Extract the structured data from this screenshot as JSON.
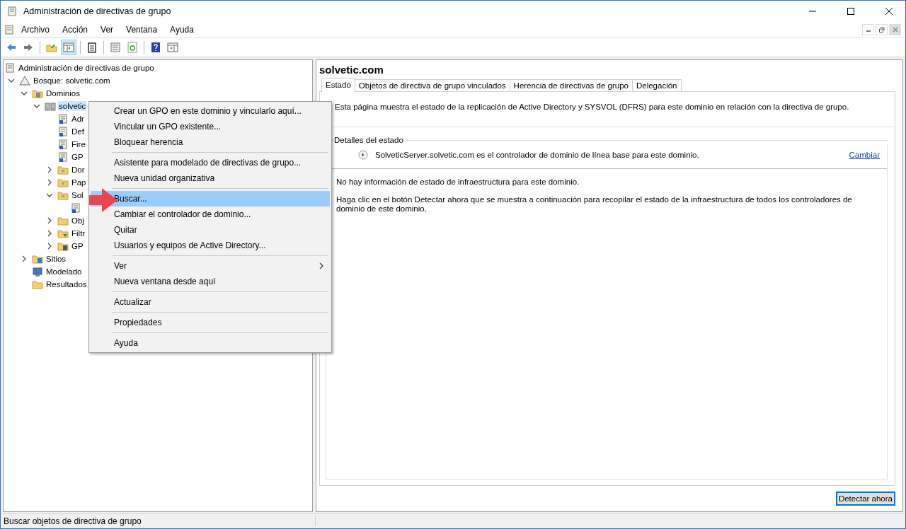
{
  "window": {
    "title": "Administración de directivas de grupo"
  },
  "menu_bar": [
    "Archivo",
    "Acción",
    "Ver",
    "Ventana",
    "Ayuda"
  ],
  "toolbar": [
    {
      "kind": "back",
      "pressed": false
    },
    {
      "kind": "forward",
      "pressed": false
    },
    {
      "kind": "separator"
    },
    {
      "kind": "up-folder",
      "pressed": false
    },
    {
      "kind": "tree-pane",
      "pressed": true
    },
    {
      "kind": "separator"
    },
    {
      "kind": "clipboard",
      "pressed": false
    },
    {
      "kind": "separator"
    },
    {
      "kind": "export",
      "pressed": false
    },
    {
      "kind": "refresh",
      "pressed": false
    },
    {
      "kind": "separator"
    },
    {
      "kind": "help",
      "pressed": false
    },
    {
      "kind": "action-pane",
      "pressed": false
    }
  ],
  "tree": [
    {
      "label": "Administración de directivas de grupo",
      "kind": "root",
      "selected": false,
      "children": [
        {
          "label": "Bosque: solvetic.com",
          "kind": "forest",
          "expanded": true,
          "selected": false,
          "children": [
            {
              "label": "Dominios",
              "kind": "domains",
              "expanded": true,
              "selected": false,
              "children": [
                {
                  "label": "solvetic",
                  "kind": "domain",
                  "expanded": true,
                  "selected": true,
                  "children": [
                    {
                      "label": "Adr",
                      "kind": "gpo",
                      "selected": false
                    },
                    {
                      "label": "Def",
                      "kind": "gpo",
                      "selected": false
                    },
                    {
                      "label": "Fire",
                      "kind": "gpo",
                      "selected": false
                    },
                    {
                      "label": "GP",
                      "kind": "gpo",
                      "selected": false
                    },
                    {
                      "label": "Dor",
                      "kind": "ou",
                      "expanded": false,
                      "selected": false
                    },
                    {
                      "label": "Pap",
                      "kind": "ou",
                      "expanded": false,
                      "selected": false
                    },
                    {
                      "label": "Sol",
                      "kind": "ou",
                      "expanded": true,
                      "selected": false,
                      "children": [
                        {
                          "kind": "gpo"
                        }
                      ]
                    },
                    {
                      "label": "Obj",
                      "kind": "gpo-folder",
                      "expanded": false,
                      "selected": false
                    },
                    {
                      "label": "Filtr",
                      "kind": "filter-folder",
                      "expanded": false,
                      "selected": false
                    },
                    {
                      "label": "GP",
                      "kind": "starter-folder",
                      "expanded": false,
                      "selected": false
                    }
                  ]
                }
              ]
            },
            {
              "label": "Sitios",
              "kind": "sites",
              "expanded": false,
              "selected": false
            },
            {
              "label": "Modelado",
              "kind": "modeling",
              "selected": false
            },
            {
              "label": "Resultados",
              "kind": "results",
              "selected": false
            }
          ]
        }
      ]
    }
  ],
  "context_menu": [
    [
      {
        "label": "Crear un GPO en este dominio y vincularlo aquí...",
        "selected": false,
        "submenu": false
      },
      {
        "label": "Vincular un GPO existente...",
        "selected": false,
        "submenu": false
      },
      {
        "label": "Bloquear herencia",
        "selected": false,
        "submenu": false
      }
    ],
    [
      {
        "label": "Asistente para modelado de directivas de grupo...",
        "selected": false,
        "submenu": false
      },
      {
        "label": "Nueva unidad organizativa",
        "selected": false,
        "submenu": false
      }
    ],
    [
      {
        "label": "Buscar...",
        "selected": true,
        "submenu": false
      },
      {
        "label": "Cambiar el controlador de dominio...",
        "selected": false,
        "submenu": false
      },
      {
        "label": "Quitar",
        "selected": false,
        "submenu": false
      },
      {
        "label": "Usuarios y equipos de Active Directory...",
        "selected": false,
        "submenu": false
      }
    ],
    [
      {
        "label": "Ver",
        "selected": false,
        "submenu": true
      },
      {
        "label": "Nueva ventana desde aquí",
        "selected": false,
        "submenu": false
      }
    ],
    [
      {
        "label": "Actualizar",
        "selected": false,
        "submenu": false
      }
    ],
    [
      {
        "label": "Propiedades",
        "selected": false,
        "submenu": false
      }
    ],
    [
      {
        "label": "Ayuda",
        "selected": false,
        "submenu": false
      }
    ]
  ],
  "details": {
    "title": "solvetic.com",
    "tabs": [
      {
        "label": "Estado",
        "selected": true
      },
      {
        "label": "Objetos de directiva de grupo vinculados",
        "selected": false
      },
      {
        "label": "Herencia de directivas de grupo",
        "selected": false
      },
      {
        "label": "Delegación",
        "selected": false
      }
    ],
    "description": "Esta página muestra el estado de la replicación de Active Directory y SYSVOL (DFRS) para este dominio en relación con la directiva de grupo.",
    "group_title": "Detalles del estado",
    "baseline": "SolveticServer.solvetic.com es el controlador de dominio de línea base para este dominio.",
    "change_link": "Cambiar",
    "paragraphs": [
      "No hay información de estado de infraestructura para este dominio.",
      "Haga clic en el botón Detectar ahora que se muestra a continuación para recopilar el estado de la infraestructura de todos los controladores de dominio de este dominio."
    ],
    "button": "Detectar ahora"
  },
  "status_bar": "Buscar objetos de directiva de grupo"
}
